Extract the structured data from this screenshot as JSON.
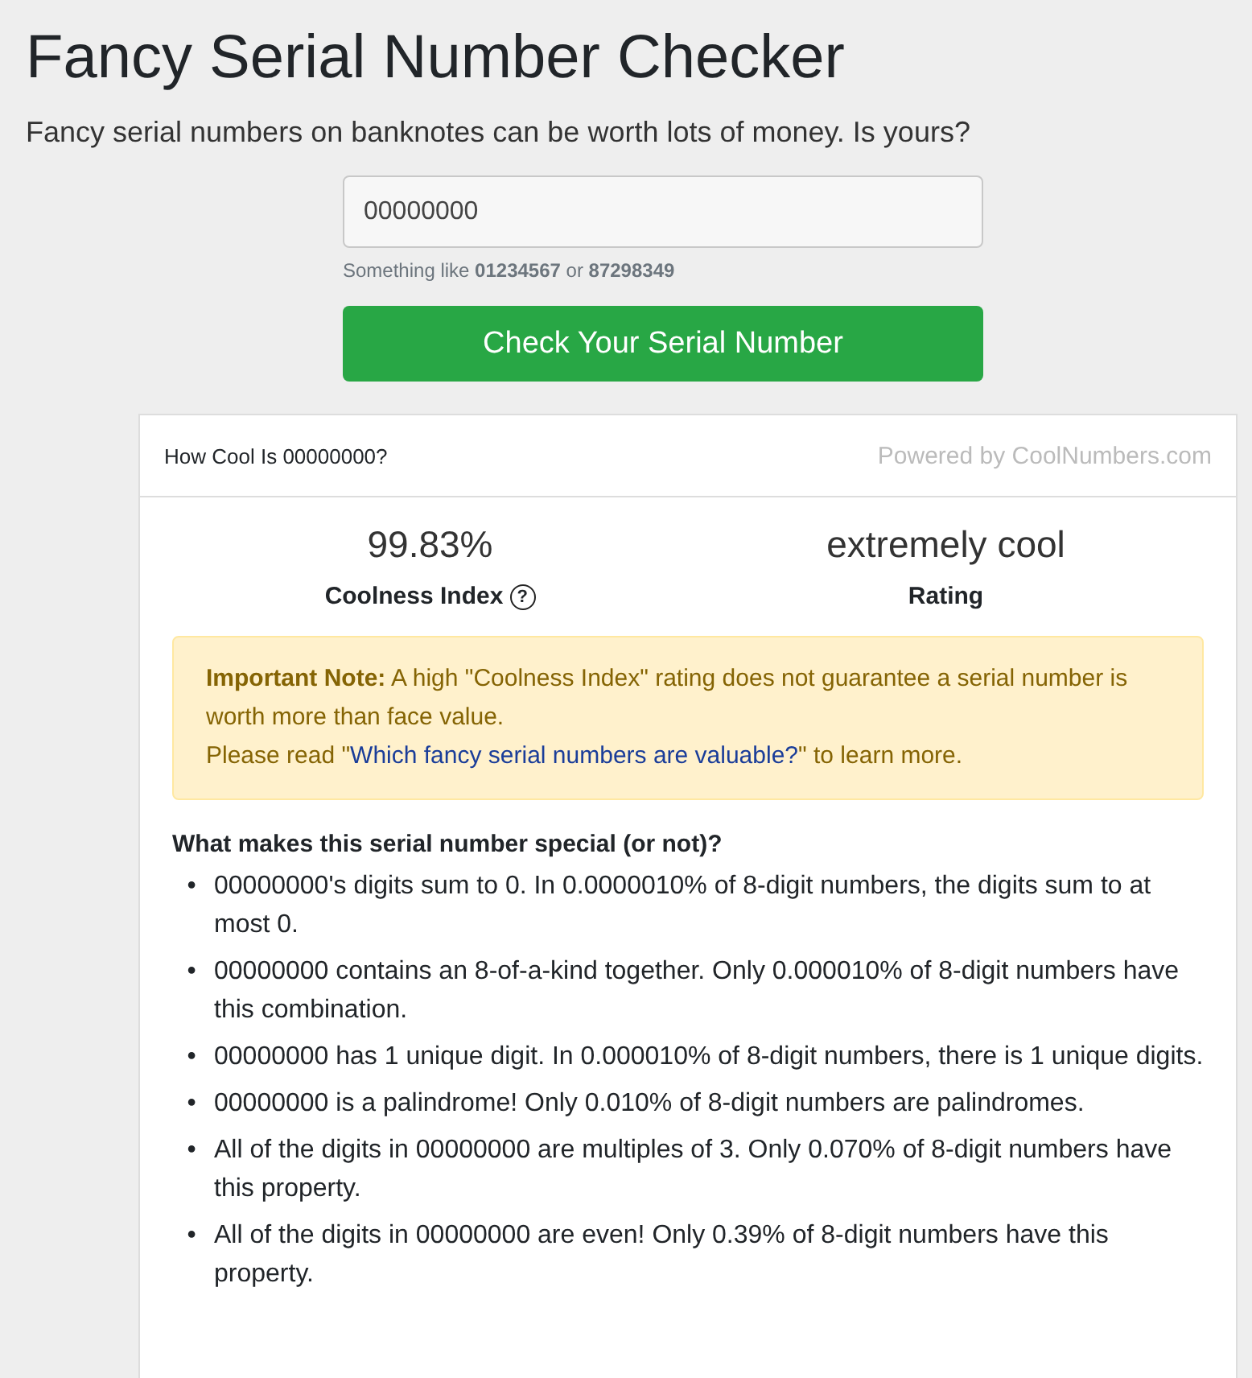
{
  "title": "Fancy Serial Number Checker",
  "subtitle": "Fancy serial numbers on banknotes can be worth lots of money. Is yours?",
  "serial_field": {
    "value": "00000000"
  },
  "hint": "Something like **01234567** or **87298349**",
  "check_button": "Check Your Serial Number",
  "result_card": {
    "header": "How Cool Is 00000000?",
    "powered_by": "Powered by CoolNumbers.com",
    "stats": [
      {
        "value": "99.83%",
        "label": "Coolness Index",
        "help_icon": "?"
      },
      {
        "value": "extremely cool",
        "label": "Rating"
      }
    ],
    "note": {
      "text": "**Important Note:** A high \"Coolness Index\" rating does not guarantee a serial number is worth more than face value.",
      "read_prefix": "Please read \"",
      "link": "Which fancy serial numbers are valuable?",
      "read_suffix": "\" to learn more."
    },
    "features_heading": "What makes this serial number special (or not)?",
    "features": [
      {
        "bullet": "•",
        "text": "00000000's digits sum to 0. In 0.0000010% of 8-digit numbers, the digits sum to at most 0."
      },
      {
        "bullet": "•",
        "text": "00000000 contains an 8-of-a-kind together. Only 0.000010% of 8-digit numbers have this combination."
      },
      {
        "bullet": "•",
        "text": "00000000 has 1 unique digit. In 0.000010% of 8-digit numbers, there is 1 unique digits."
      },
      {
        "bullet": "•",
        "text": "00000000 is a palindrome! Only 0.010% of 8-digit numbers are palindromes."
      },
      {
        "bullet": "•",
        "text": "All of the digits in 00000000 are multiples of 3. Only 0.070% of 8-digit numbers have this property."
      },
      {
        "bullet": "•",
        "text": "All of the digits in 00000000 are even! Only 0.39% of 8-digit numbers have this property."
      }
    ]
  }
}
